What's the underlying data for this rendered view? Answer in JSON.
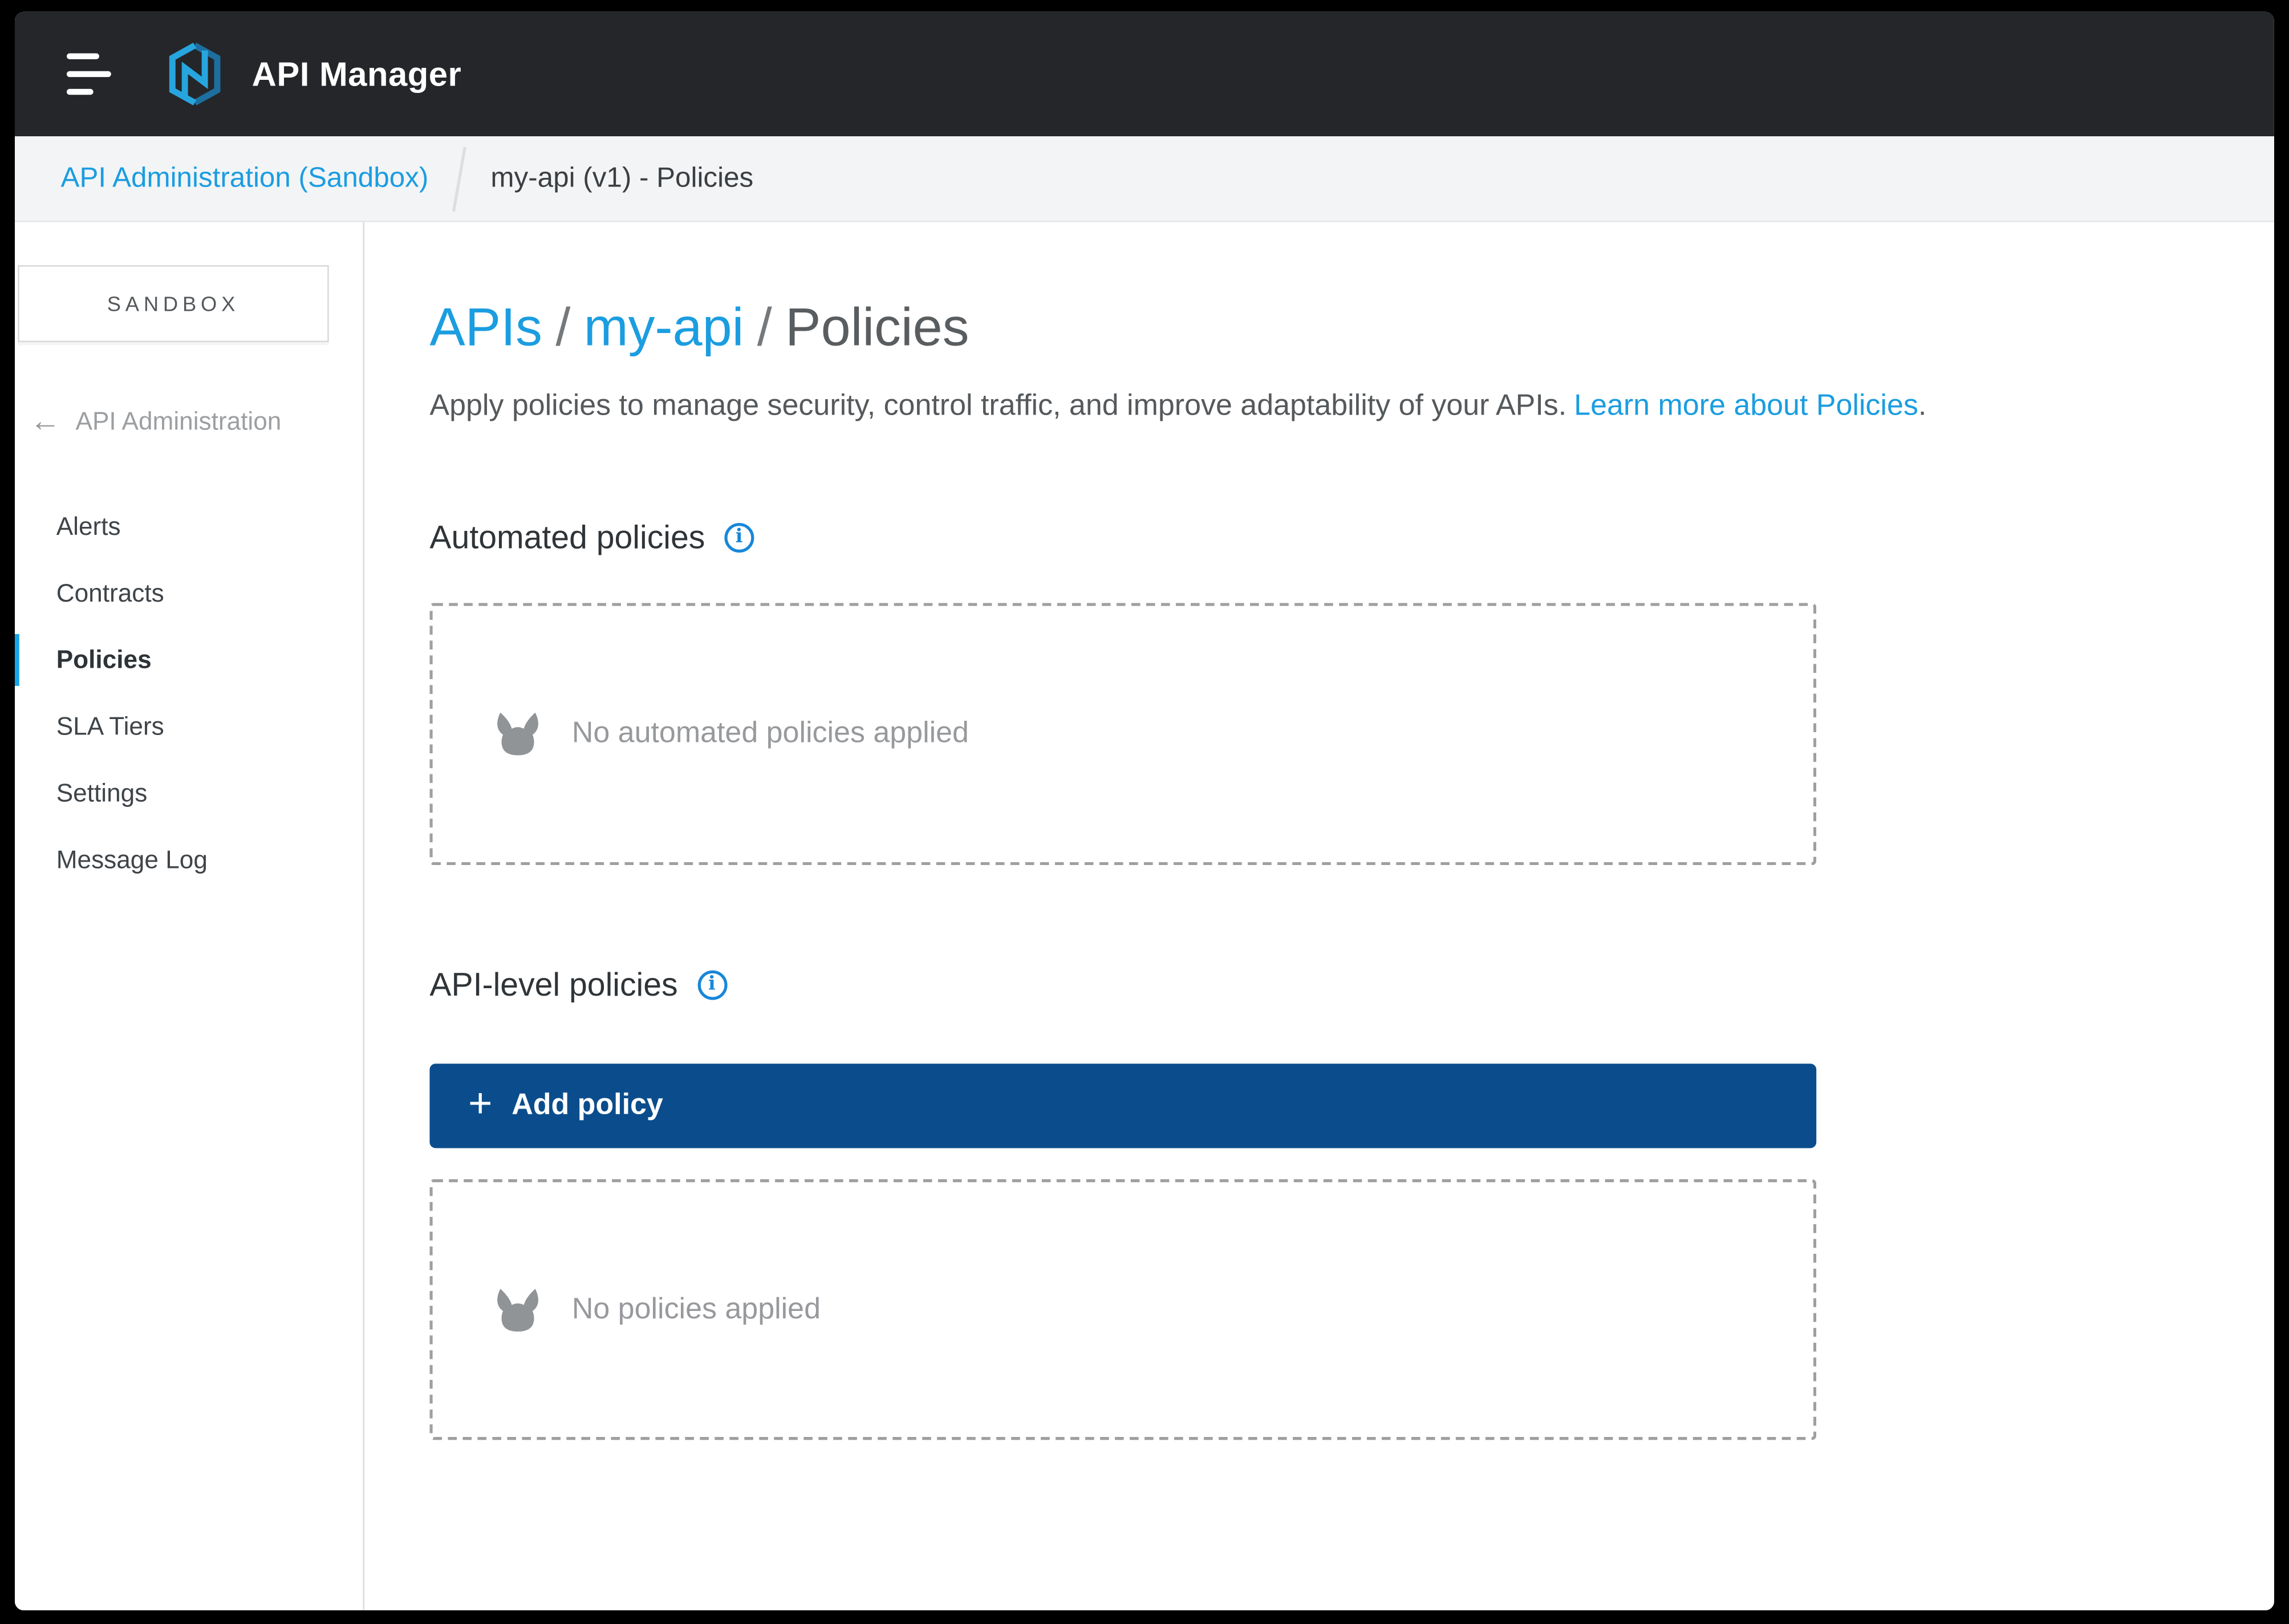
{
  "topbar": {
    "app_title": "API Manager"
  },
  "breadcrumb": {
    "items": [
      {
        "label": "API Administration (Sandbox)"
      },
      {
        "label": "my-api (v1) - Policies"
      }
    ]
  },
  "sidebar": {
    "environment": "SANDBOX",
    "back_label": "API Administration",
    "items": [
      {
        "label": "Alerts",
        "active": false
      },
      {
        "label": "Contracts",
        "active": false
      },
      {
        "label": "Policies",
        "active": true
      },
      {
        "label": "SLA Tiers",
        "active": false
      },
      {
        "label": "Settings",
        "active": false
      },
      {
        "label": "Message Log",
        "active": false
      }
    ]
  },
  "main": {
    "title": {
      "part1": "APIs",
      "separator": "/",
      "part2": "my-api",
      "part3": "Policies"
    },
    "description": "Apply policies to manage security, control traffic, and improve adaptability of your APIs.",
    "learn_more_link": "Learn more about Policies",
    "learn_more_suffix": ".",
    "automated": {
      "heading": "Automated policies",
      "empty_text": "No automated policies applied"
    },
    "api_level": {
      "heading": "API-level policies",
      "add_button_plus": "+",
      "add_button_label": "Add policy",
      "empty_text": "No policies applied"
    }
  },
  "icons": {
    "info_glyph": "i",
    "back_arrow": "←"
  },
  "colors": {
    "link_blue": "#1b9de0",
    "info_blue": "#1787d9",
    "active_accent": "#16a5e9",
    "button_navy": "#0b4d8c",
    "topbar_bg": "#242629",
    "breadcrumb_bg": "#f3f4f6",
    "empty_gray": "#97999c"
  }
}
